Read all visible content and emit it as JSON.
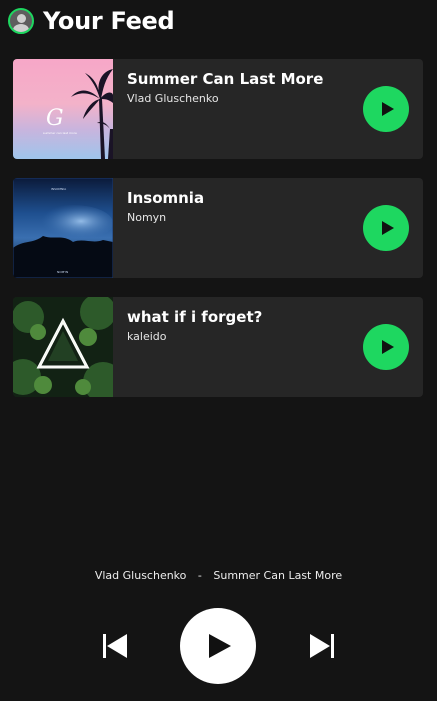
{
  "header": {
    "title": "Your Feed",
    "avatar_icon": "user-avatar-icon"
  },
  "colors": {
    "background": "#141414",
    "card": "#262626",
    "accent": "#1ed760",
    "text": "#ffffff"
  },
  "feed": {
    "items": [
      {
        "title": "Summer Can Last More",
        "artist": "Vlad Gluschenko",
        "play_icon": "play-icon"
      },
      {
        "title": "Insomnia",
        "artist": "Nomyn",
        "play_icon": "play-icon"
      },
      {
        "title": "what if i forget?",
        "artist": "kaleido",
        "play_icon": "play-icon"
      }
    ]
  },
  "player": {
    "artist": "Vlad Gluschenko",
    "separator": "-",
    "title": "Summer Can Last More",
    "prev_icon": "skip-previous-icon",
    "play_icon": "play-icon",
    "next_icon": "skip-next-icon"
  }
}
